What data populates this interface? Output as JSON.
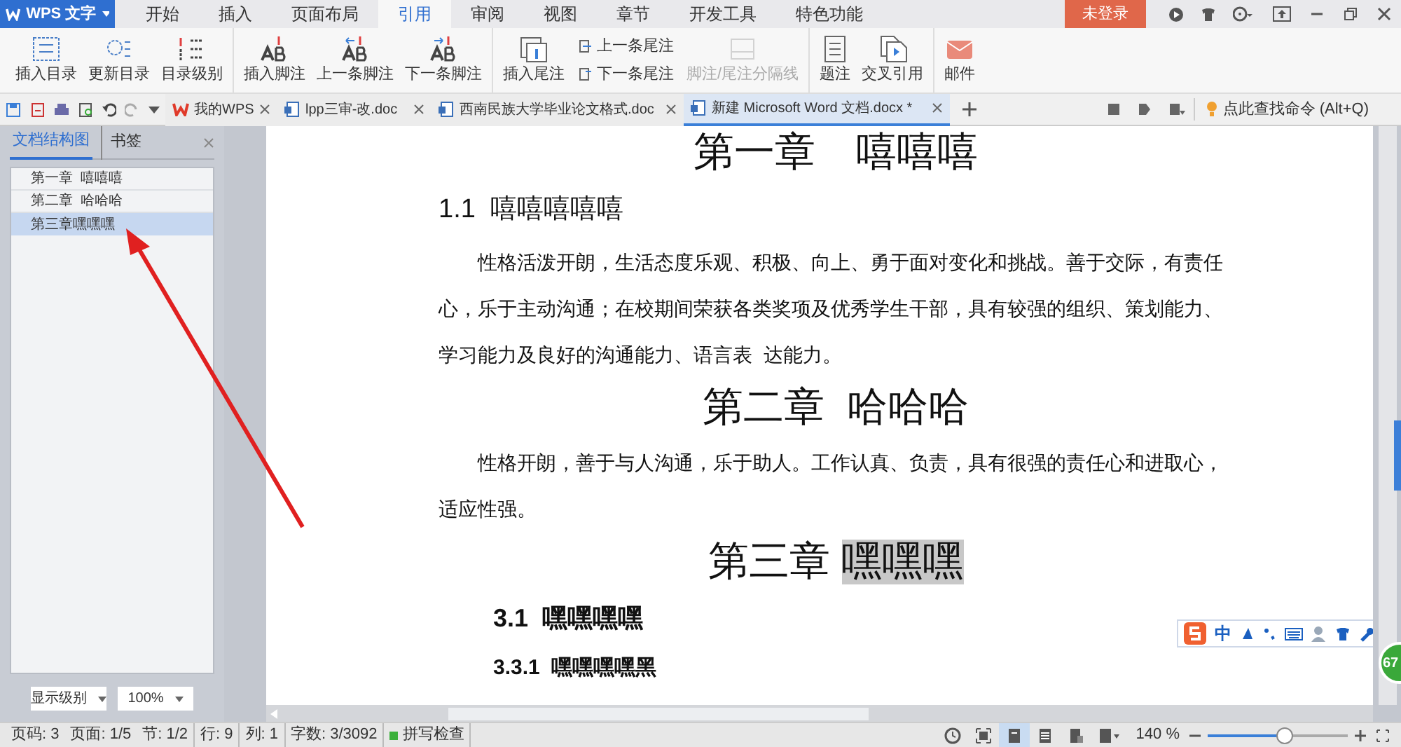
{
  "app_button": "WPS 文字",
  "menu_tabs": [
    {
      "label": "开始",
      "selected": false
    },
    {
      "label": "插入",
      "selected": false
    },
    {
      "label": "页面布局",
      "selected": false
    },
    {
      "label": "引用",
      "selected": true
    },
    {
      "label": "审阅",
      "selected": false
    },
    {
      "label": "视图",
      "selected": false
    },
    {
      "label": "章节",
      "selected": false
    },
    {
      "label": "开发工具",
      "selected": false
    },
    {
      "label": "特色功能",
      "selected": false
    }
  ],
  "login_button": "未登录",
  "ribbon_groups": [
    {
      "items": [
        {
          "kind": "large",
          "label": "插入目录",
          "disabled": false
        },
        {
          "kind": "large",
          "label": "更新目录",
          "disabled": false
        },
        {
          "kind": "large",
          "label": "目录级别",
          "disabled": false
        }
      ]
    },
    {
      "items": [
        {
          "kind": "large",
          "label": "插入脚注",
          "disabled": false
        },
        {
          "kind": "large",
          "label": "上一条脚注",
          "disabled": false
        },
        {
          "kind": "large",
          "label": "下一条脚注",
          "disabled": false
        }
      ]
    },
    {
      "items": [
        {
          "kind": "large",
          "label": "插入尾注",
          "disabled": false
        },
        {
          "kind": "small",
          "label": "上一条尾注",
          "disabled": false
        },
        {
          "kind": "small",
          "label": "下一条尾注",
          "disabled": false
        },
        {
          "kind": "large",
          "label": "脚注/尾注分隔线",
          "disabled": true
        }
      ]
    },
    {
      "items": [
        {
          "kind": "large",
          "label": "题注",
          "disabled": false
        },
        {
          "kind": "large",
          "label": "交叉引用",
          "disabled": false
        }
      ]
    },
    {
      "items": [
        {
          "kind": "large",
          "label": "邮件",
          "disabled": false
        }
      ]
    }
  ],
  "doc_tabs": [
    {
      "title": "我的WPS",
      "selected": false
    },
    {
      "title": "lpp三审-改.doc",
      "selected": false
    },
    {
      "title": "西南民族大学毕业论文格式.doc",
      "selected": false
    },
    {
      "title": "新建 Microsoft Word 文档.docx *",
      "selected": true
    }
  ],
  "command_search": "点此查找命令 (Alt+Q)",
  "nav_panel": {
    "tabs": [
      {
        "label": "文档结构图",
        "selected": true
      },
      {
        "label": "书签",
        "selected": false
      }
    ],
    "items": [
      {
        "label": "第一章  嘻嘻嘻",
        "selected": false
      },
      {
        "label": "第二章  哈哈哈",
        "selected": false
      },
      {
        "label": "第三章嘿嘿嘿",
        "selected": true
      }
    ],
    "level_dropdown": "显示级别",
    "zoom_dropdown": "100%"
  },
  "document": [
    {
      "kind": "h1",
      "parts": [
        {
          "text": "第一章　嘻嘻嘻",
          "highlighted": false
        }
      ]
    },
    {
      "kind": "h2",
      "parts": [
        {
          "text": "1.1  嘻嘻嘻嘻嘻",
          "highlighted": false
        }
      ]
    },
    {
      "kind": "p",
      "parts": [
        {
          "text": "性格活泼开朗，生活态度乐观、积极、向上、勇于面对变化和挑战。善于交际，有责任心，乐于主动沟通；在校期间荣获各类奖项及优秀学生干部，具有较强的组织、策划能力、学习能力及良好的沟通能力、语言表  达能力。",
          "highlighted": false
        }
      ]
    },
    {
      "kind": "h1",
      "parts": [
        {
          "text": "第二章  哈哈哈",
          "highlighted": false
        }
      ]
    },
    {
      "kind": "p",
      "parts": [
        {
          "text": "性格开朗，善于与人沟通，乐于助人。工作认真、负责，具有很强的责任心和进取心，适应性强。",
          "highlighted": false
        }
      ]
    },
    {
      "kind": "h1",
      "parts": [
        {
          "text": "第三章 ",
          "highlighted": false
        },
        {
          "text": "嘿嘿嘿",
          "highlighted": true
        }
      ]
    },
    {
      "kind": "h3",
      "parts": [
        {
          "text": "3.1  嘿嘿嘿嘿",
          "highlighted": false
        }
      ]
    },
    {
      "kind": "h4",
      "parts": [
        {
          "text": "3.3.1  嘿嘿嘿嘿黑",
          "highlighted": false
        }
      ]
    }
  ],
  "ime_toolbar": {
    "language": "中"
  },
  "side_badge": "67",
  "status_bar": {
    "items": [
      "页码: 3",
      "页面: 1/5",
      "节: 1/2",
      "行: 9",
      "列: 1",
      "字数: 3/3092"
    ],
    "spell_check": "拼写检查",
    "zoom": "140 %",
    "zoom_slider": {
      "level": 0.55
    }
  }
}
